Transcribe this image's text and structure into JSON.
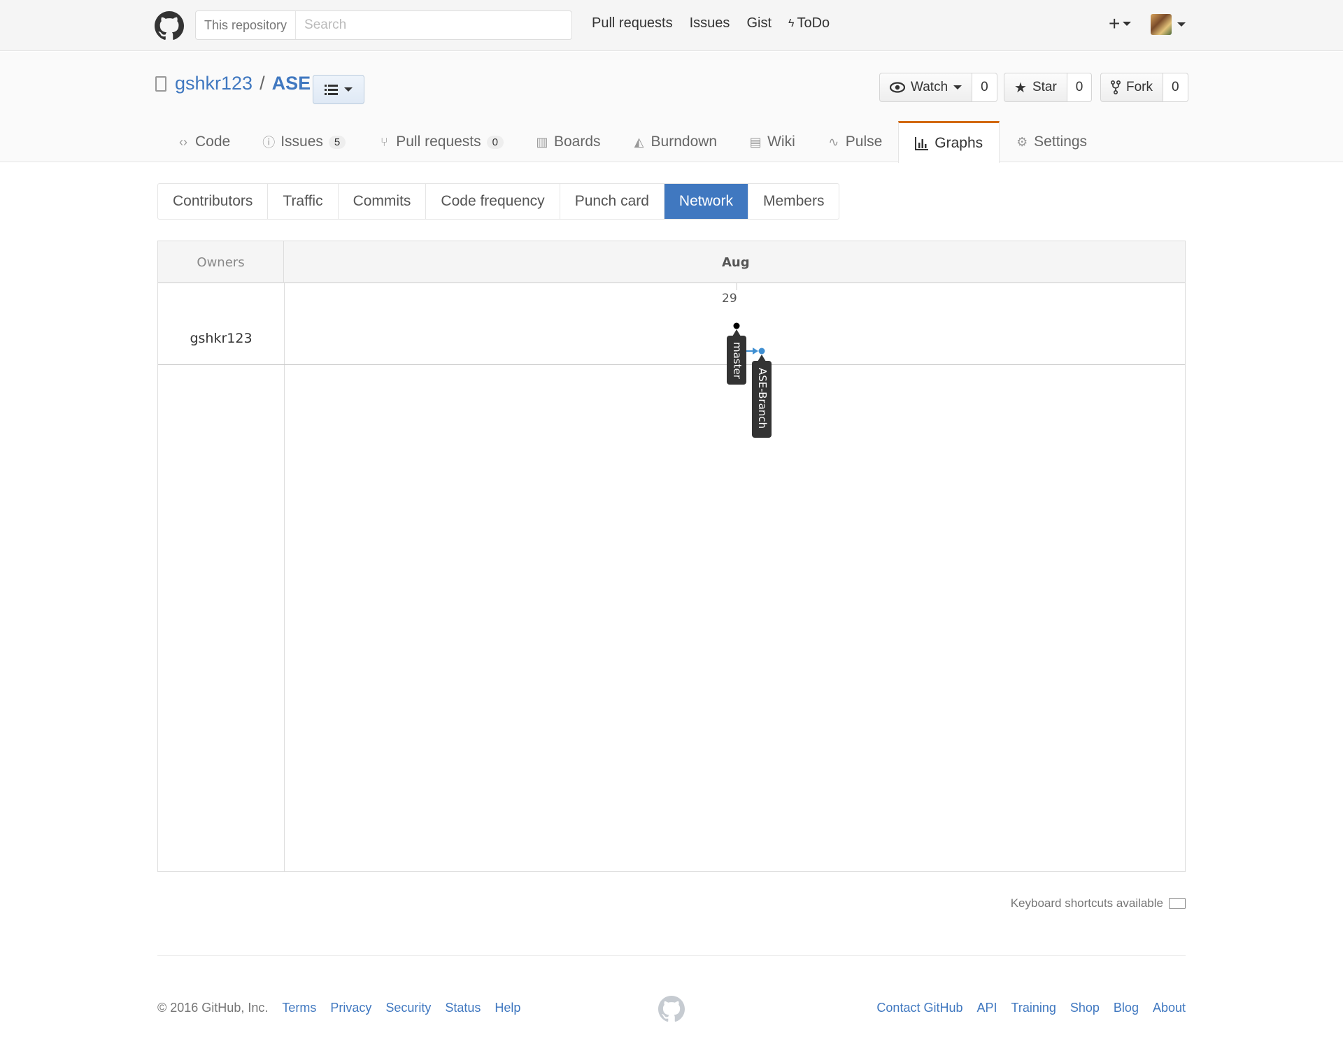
{
  "header": {
    "search_scope": "This repository",
    "search_placeholder": "Search",
    "nav": [
      "Pull requests",
      "Issues",
      "Gist",
      "ToDo"
    ],
    "plus": "+"
  },
  "repo": {
    "owner": "gshkr123",
    "separator": "/",
    "name": "ASE",
    "watch_label": "Watch",
    "watch_count": "0",
    "star_label": "Star",
    "star_count": "0",
    "fork_label": "Fork",
    "fork_count": "0"
  },
  "reponav": {
    "code": "Code",
    "issues": "Issues",
    "issues_count": "5",
    "pulls": "Pull requests",
    "pulls_count": "0",
    "boards": "Boards",
    "burndown": "Burndown",
    "wiki": "Wiki",
    "pulse": "Pulse",
    "graphs": "Graphs",
    "settings": "Settings"
  },
  "subnav": [
    "Contributors",
    "Traffic",
    "Commits",
    "Code frequency",
    "Punch card",
    "Network",
    "Members"
  ],
  "subnav_active": "Network",
  "network": {
    "owners_header": "Owners",
    "month": "Aug",
    "day": "29",
    "owner": "gshkr123",
    "branches": [
      {
        "name": "master",
        "color": "#000000"
      },
      {
        "name": "ASE-Branch",
        "color": "#3f8fd2"
      }
    ]
  },
  "keyboard_hint": "Keyboard shortcuts available",
  "footer": {
    "copyright": "© 2016 GitHub, Inc.",
    "left_links": [
      "Terms",
      "Privacy",
      "Security",
      "Status",
      "Help"
    ],
    "right_links": [
      "Contact GitHub",
      "API",
      "Training",
      "Shop",
      "Blog",
      "About"
    ]
  },
  "colors": {
    "link": "#4078c0",
    "active_tab": "#d26911",
    "subnav_active": "#4078c0"
  }
}
